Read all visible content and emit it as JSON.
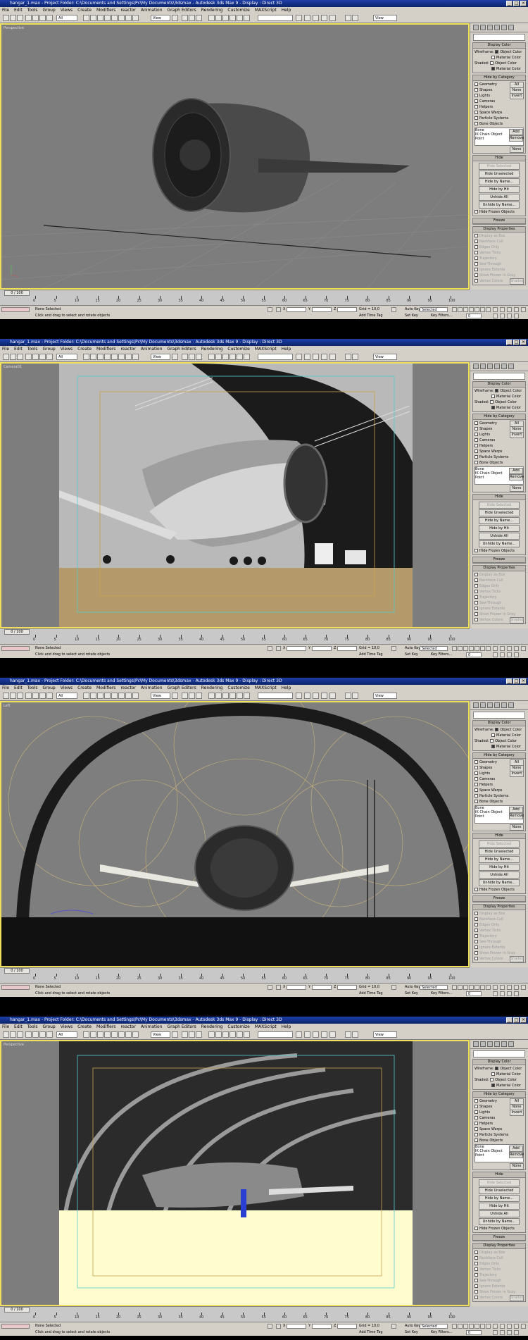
{
  "window": {
    "shot1_title": "hangar_1.max - Project Folder: C:\\Documents and Settings\\Pc\\My Documents\\3dsmax - Autodesk 3ds Max 9 - Display : Direct 3D",
    "shot2_title": "hangar_1.max - Project Folder: C:\\Documents and Settings\\Pc\\My Documents\\3dsmax - Autodesk 3ds Max 9 - Display : Direct 3D",
    "shot3_title": "hangar_1.max - Project Folder: C:\\Documents and Settings\\Pc\\My Documents\\3dsmax - Autodesk 3ds Max 9 - Display : Direct 3D",
    "shot4_title": "hangar_1.max - Project Folder: C:\\Documents and Settings\\Pc\\My Documents\\3dsmax - Autodesk 3ds Max 9 - Display : Direct 3D"
  },
  "menu": [
    "File",
    "Edit",
    "Tools",
    "Group",
    "Views",
    "Create",
    "Modifiers",
    "reactor",
    "Animation",
    "Graph Editors",
    "Rendering",
    "Customize",
    "MAXScript",
    "Help"
  ],
  "toolbar": {
    "selection_filter": "All",
    "ref_coord": "View",
    "ref_coord2": "View"
  },
  "viewports": {
    "shot1_label": "Perspective",
    "shot2_label": "Camera01",
    "shot3_label": "Left",
    "shot4_label": "Perspective"
  },
  "panel": {
    "display_color": "Display Color",
    "wireframe": "Wireframe:",
    "shaded": "Shaded:",
    "object_color": "Object Color",
    "material_color": "Material Color",
    "hide_by_category": "Hide by Category",
    "categories": [
      "Geometry",
      "Shapes",
      "Lights",
      "Cameras",
      "Helpers",
      "Space Warps",
      "Particle Systems",
      "Bone Objects"
    ],
    "all": "All",
    "none": "None",
    "invert": "Invert",
    "list_items": [
      "Bone",
      "IK Chain Object",
      "Point"
    ],
    "add": "Add",
    "remove": "Remove",
    "none2": "None",
    "hide": "Hide",
    "hide_buttons": [
      "Hide Selected",
      "Hide Unselected",
      "Hide by Name...",
      "Hide by Hit"
    ],
    "unhide_buttons": [
      "Unhide All",
      "Unhide by Name..."
    ],
    "hide_frozen": "Hide Frozen Objects",
    "freeze": "Freeze",
    "display_properties": "Display Properties",
    "props": [
      "Display as Box",
      "Backface Cull",
      "Edges Only",
      "Vertex Ticks",
      "Trajectory",
      "See-Through",
      "Ignore Extents",
      "Show Frozen in Gray",
      "Vertex Colors"
    ],
    "shaded_btn": "Shaded"
  },
  "timeline": {
    "slider": "0 / 100",
    "ticks": [
      "0",
      "5",
      "10",
      "15",
      "20",
      "25",
      "30",
      "35",
      "40",
      "45",
      "50",
      "55",
      "60",
      "65",
      "70",
      "75",
      "80",
      "85",
      "90",
      "95",
      "100"
    ]
  },
  "status": {
    "none_selected": "None Selected",
    "prompt": "Click and drag to select and rotate objects",
    "grid": "Grid = 10,0",
    "add_time_tag": "Add Time Tag",
    "auto_key": "Auto Key",
    "set_key": "Set Key",
    "selected": "Selected",
    "key_filters": "Key Filters...",
    "frame": "0",
    "x_label": "X",
    "y_label": "Y",
    "z_label": "Z"
  }
}
